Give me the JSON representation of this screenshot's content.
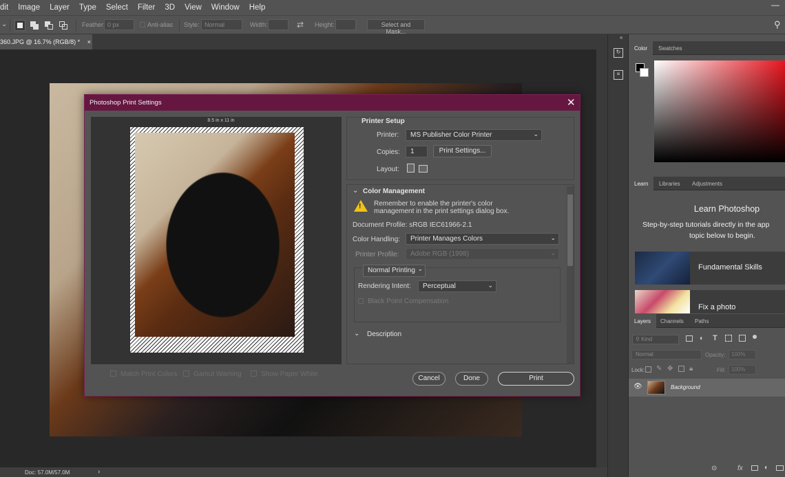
{
  "menubar": {
    "items": [
      "dit",
      "Image",
      "Layer",
      "Type",
      "Select",
      "Filter",
      "3D",
      "View",
      "Window",
      "Help"
    ]
  },
  "options_bar": {
    "feather_label": "Feather:",
    "feather_value": "0 px",
    "antialias_label": "Anti-alias",
    "style_label": "Style:",
    "style_value": "Normal",
    "width_label": "Width:",
    "height_label": "Height:",
    "select_mask": "Select and Mask..."
  },
  "document": {
    "tab_title": "360.JPG @ 16.7% (RGB/8) *",
    "close": "×"
  },
  "status": {
    "doc": "Doc: 57.0M/57.0M",
    "arrow": "›"
  },
  "panels": {
    "color_tabs": [
      "Color",
      "Swatches"
    ],
    "learn_tabs": [
      "Learn",
      "Libraries",
      "Adjustments"
    ],
    "learn_title": "Learn Photoshop",
    "learn_sub_1": "Step-by-step tutorials directly in the app",
    "learn_sub_2": "topic below to begin.",
    "learn_cards": [
      "Fundamental Skills",
      "Fix a photo"
    ],
    "layers_tabs": [
      "Layers",
      "Channels",
      "Paths"
    ],
    "kind_placeholder": "Kind",
    "blend_mode": "Normal",
    "opacity_label": "Opacity:",
    "opacity_value": "100%",
    "lock_label": "Lock:",
    "fill_label": "Fill:",
    "fill_value": "100%",
    "layer_name": "Background",
    "bottom_fx": "fx"
  },
  "dialog": {
    "title": "Photoshop Print Settings",
    "close": "✕",
    "paper_size": "8.5 in x 11 in",
    "match_print_colors": "Match Print Colors",
    "gamut_warning": "Gamut Warning",
    "show_paper_white": "Show Paper White",
    "printer_setup": "Printer Setup",
    "printer_label": "Printer:",
    "printer_value": "MS Publisher Color Printer",
    "copies_label": "Copies:",
    "copies_value": "1",
    "print_settings": "Print Settings...",
    "layout_label": "Layout:",
    "color_management": "Color Management",
    "warning_1": "Remember to enable the printer's color",
    "warning_2": "management in the print settings dialog box.",
    "document_profile": "Document Profile: sRGB IEC61966-2.1",
    "color_handling_label": "Color Handling:",
    "color_handling_value": "Printer Manages Colors",
    "printer_profile_label": "Printer Profile:",
    "printer_profile_value": "Adobe RGB (1998)",
    "normal_printing": "Normal Printing",
    "rendering_intent_label": "Rendering Intent:",
    "rendering_intent_value": "Perceptual",
    "black_point": "Black Point Compensation",
    "description": "Description",
    "cancel": "Cancel",
    "done": "Done",
    "print": "Print"
  }
}
